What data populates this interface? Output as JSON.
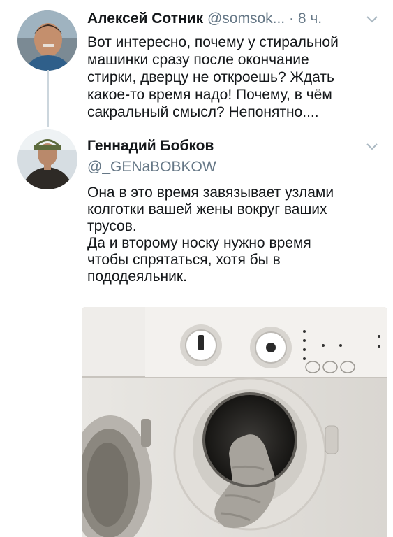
{
  "tweet1": {
    "name": "Алексей Сотник",
    "handle": "@somsok...",
    "dot": "·",
    "time": "8 ч.",
    "text": "Вот интересно, почему у стиральной\nмашинки сразу после окончание\nстирки, дверцу не откроешь? Ждать\nкакое-то время надо! Почему, в чём\nсакральный смысл? Непонятно...."
  },
  "tweet2": {
    "name": "Геннадий Бобков",
    "handle": "@_GENaBOBKOW",
    "text": "Она в это время завязывает узлами\nколготки вашей жены вокруг ваших\nтрусов.\nДа и второму носку нужно время\nчтобы спрятаться, хотя бы в\nпододеяльник."
  },
  "icons": {
    "menu": "chevron-down-icon"
  },
  "colors": {
    "secondary_text": "#657786",
    "thread_line": "#ccd6dd"
  }
}
